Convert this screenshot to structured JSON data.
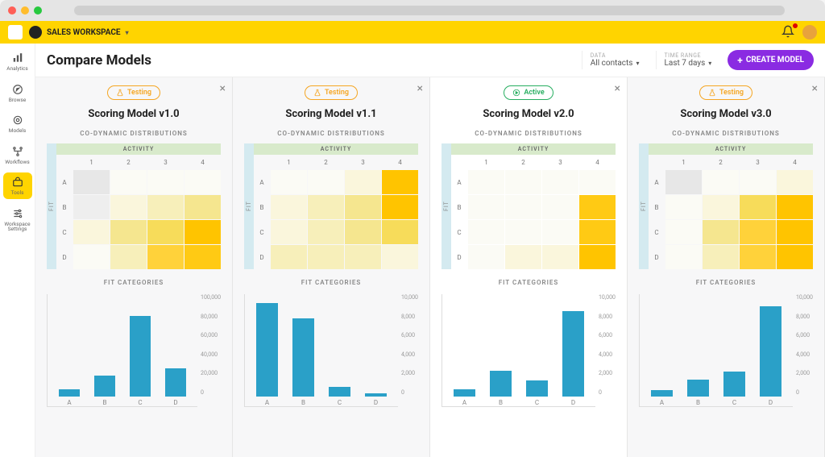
{
  "workspace": {
    "label": "SALES WORKSPACE"
  },
  "page": {
    "title": "Compare Models"
  },
  "filters": {
    "data": {
      "label": "DATA",
      "value": "All contacts"
    },
    "time": {
      "label": "TIME RANGE",
      "value": "Last 7 days"
    }
  },
  "create_button": "CREATE MODEL",
  "sidenav": {
    "items": [
      {
        "label": "Analytics",
        "icon": "bars"
      },
      {
        "label": "Browse",
        "icon": "compass"
      },
      {
        "label": "Models",
        "icon": "target"
      },
      {
        "label": "Workflows",
        "icon": "flow"
      },
      {
        "label": "Tools",
        "icon": "toolbox",
        "active": true
      },
      {
        "label": "Workspace Settings",
        "icon": "sliders"
      }
    ]
  },
  "status_labels": {
    "testing": "Testing",
    "active": "Active"
  },
  "section_titles": {
    "heatmap": "CO-DYNAMIC DISTRIBUTIONS",
    "bars": "FIT CATEGORIES"
  },
  "heatmap_axes": {
    "x": "ACTIVITY",
    "y": "FIT",
    "cols": [
      "1",
      "2",
      "3",
      "4"
    ],
    "rows": [
      "A",
      "B",
      "C",
      "D"
    ]
  },
  "models": [
    {
      "name": "Scoring Model v1.0",
      "status": "testing",
      "active_card": false
    },
    {
      "name": "Scoring Model v1.1",
      "status": "testing",
      "active_card": false
    },
    {
      "name": "Scoring Model v2.0",
      "status": "active",
      "active_card": true
    },
    {
      "name": "Scoring Model v3.0",
      "status": "testing",
      "active_card": false
    }
  ],
  "chart_data": [
    {
      "model": "Scoring Model v1.0",
      "heatmap": {
        "type": "heatmap",
        "x_categories": [
          "1",
          "2",
          "3",
          "4"
        ],
        "y_categories": [
          "A",
          "B",
          "C",
          "D"
        ],
        "intensity": [
          [
            0.15,
            0.05,
            0.05,
            0.05
          ],
          [
            0.15,
            0.1,
            0.2,
            0.25
          ],
          [
            0.1,
            0.25,
            0.5,
            0.95
          ],
          [
            0.05,
            0.2,
            0.65,
            0.7
          ]
        ],
        "xlabel": "ACTIVITY",
        "ylabel": "FIT"
      },
      "bars": {
        "type": "bar",
        "categories": [
          "A",
          "B",
          "C",
          "D"
        ],
        "values": [
          8000,
          22000,
          85000,
          30000
        ],
        "ylabel": "",
        "ylim": [
          0,
          100000
        ],
        "yticks": [
          100000,
          80000,
          60000,
          40000,
          20000,
          0
        ],
        "ytick_labels": [
          "100,000",
          "80,000",
          "60,000",
          "40,000",
          "20,000",
          "0"
        ]
      }
    },
    {
      "model": "Scoring Model v1.1",
      "heatmap": {
        "type": "heatmap",
        "x_categories": [
          "1",
          "2",
          "3",
          "4"
        ],
        "y_categories": [
          "A",
          "B",
          "C",
          "D"
        ],
        "intensity": [
          [
            0.05,
            0.05,
            0.1,
            0.9
          ],
          [
            0.1,
            0.15,
            0.25,
            0.95
          ],
          [
            0.1,
            0.2,
            0.3,
            0.5
          ],
          [
            0.15,
            0.15,
            0.15,
            0.1
          ]
        ],
        "xlabel": "ACTIVITY",
        "ylabel": "FIT"
      },
      "bars": {
        "type": "bar",
        "categories": [
          "A",
          "B",
          "C",
          "D"
        ],
        "values": [
          9800,
          8200,
          1000,
          300
        ],
        "ylabel": "",
        "ylim": [
          0,
          10000
        ],
        "yticks": [
          10000,
          8000,
          6000,
          4000,
          2000,
          0
        ],
        "ytick_labels": [
          "10,000",
          "8,000",
          "6,000",
          "4,000",
          "2,000",
          "0"
        ]
      }
    },
    {
      "model": "Scoring Model v2.0",
      "heatmap": {
        "type": "heatmap",
        "x_categories": [
          "1",
          "2",
          "3",
          "4"
        ],
        "y_categories": [
          "A",
          "B",
          "C",
          "D"
        ],
        "intensity": [
          [
            0.03,
            0.03,
            0.03,
            0.05
          ],
          [
            0.03,
            0.05,
            0.05,
            0.8
          ],
          [
            0.03,
            0.05,
            0.05,
            0.7
          ],
          [
            0.05,
            0.1,
            0.1,
            0.9
          ]
        ],
        "xlabel": "ACTIVITY",
        "ylabel": "FIT"
      },
      "bars": {
        "type": "bar",
        "categories": [
          "A",
          "B",
          "C",
          "D"
        ],
        "values": [
          800,
          2700,
          1700,
          9000
        ],
        "ylabel": "",
        "ylim": [
          0,
          10000
        ],
        "yticks": [
          10000,
          8000,
          6000,
          4000,
          2000,
          0
        ],
        "ytick_labels": [
          "10,000",
          "8,000",
          "6,000",
          "4,000",
          "2,000",
          "0"
        ]
      }
    },
    {
      "model": "Scoring Model v3.0",
      "heatmap": {
        "type": "heatmap",
        "x_categories": [
          "1",
          "2",
          "3",
          "4"
        ],
        "y_categories": [
          "A",
          "B",
          "C",
          "D"
        ],
        "intensity": [
          [
            0.15,
            0.05,
            0.05,
            0.1
          ],
          [
            0.05,
            0.1,
            0.4,
            0.85
          ],
          [
            0.05,
            0.3,
            0.6,
            0.95
          ],
          [
            0.05,
            0.2,
            0.55,
            0.9
          ]
        ],
        "xlabel": "ACTIVITY",
        "ylabel": "FIT"
      },
      "bars": {
        "type": "bar",
        "categories": [
          "A",
          "B",
          "C",
          "D"
        ],
        "values": [
          700,
          1800,
          2600,
          9500
        ],
        "ylabel": "",
        "ylim": [
          0,
          10000
        ],
        "yticks": [
          10000,
          8000,
          6000,
          4000,
          2000,
          0
        ],
        "ytick_labels": [
          "10,000",
          "8,000",
          "6,000",
          "4,000",
          "2,000",
          "0"
        ]
      }
    }
  ]
}
